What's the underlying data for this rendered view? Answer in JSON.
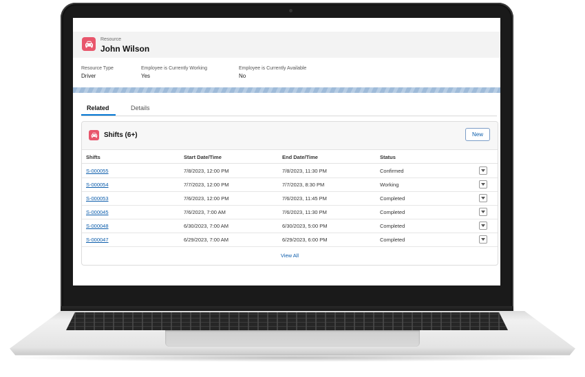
{
  "record": {
    "object_label": "Resource",
    "name": "John Wilson",
    "icon": "car-icon",
    "accent_color": "#e8566c"
  },
  "fields": [
    {
      "label": "Resource Type",
      "value": "Driver"
    },
    {
      "label": "Employee is Currently Working",
      "value": "Yes"
    },
    {
      "label": "Employee is Currently Available",
      "value": "No"
    }
  ],
  "tabs": {
    "related": "Related",
    "details": "Details",
    "active": "related"
  },
  "shifts_card": {
    "title": "Shifts (6+)",
    "icon": "car-icon",
    "new_label": "New",
    "columns": [
      "Shifts",
      "Start Date/Time",
      "End Date/Time",
      "Status"
    ],
    "rows": [
      {
        "id": "S-000055",
        "start": "7/8/2023, 12:00 PM",
        "end": "7/8/2023, 11:30 PM",
        "status": "Confirmed"
      },
      {
        "id": "S-000054",
        "start": "7/7/2023, 12:00 PM",
        "end": "7/7/2023, 8:30 PM",
        "status": "Working"
      },
      {
        "id": "S-000053",
        "start": "7/6/2023, 12:00 PM",
        "end": "7/6/2023, 11:45 PM",
        "status": "Completed"
      },
      {
        "id": "S-000045",
        "start": "7/6/2023, 7:00 AM",
        "end": "7/6/2023, 11:30 PM",
        "status": "Completed"
      },
      {
        "id": "S-000048",
        "start": "6/30/2023, 7:00 AM",
        "end": "6/30/2023, 5:00 PM",
        "status": "Completed"
      },
      {
        "id": "S-000047",
        "start": "6/29/2023, 7:00 AM",
        "end": "6/29/2023, 6:00 PM",
        "status": "Completed"
      }
    ],
    "view_all_label": "View All",
    "link_color": "#0b5cab"
  }
}
